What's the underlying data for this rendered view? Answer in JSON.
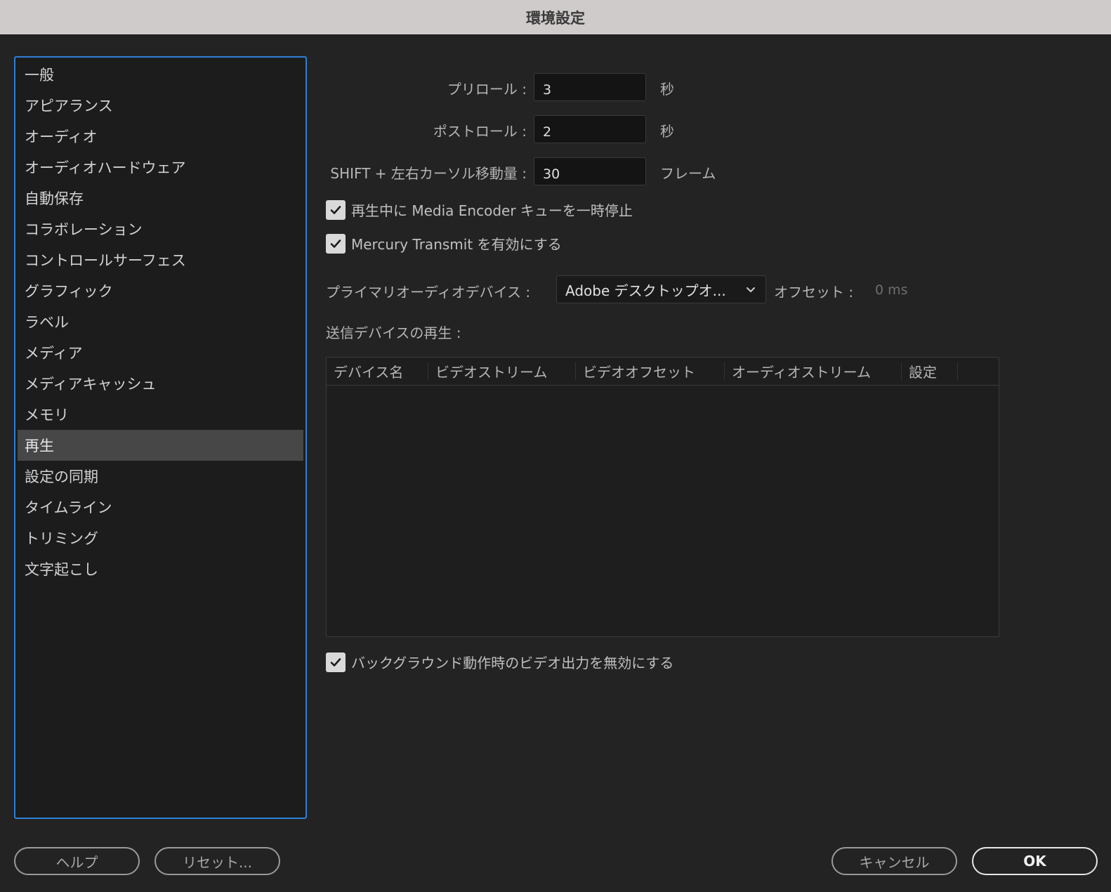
{
  "window": {
    "title": "環境設定"
  },
  "sidebar": {
    "items": [
      {
        "label": "一般"
      },
      {
        "label": "アピアランス"
      },
      {
        "label": "オーディオ"
      },
      {
        "label": "オーディオハードウェア"
      },
      {
        "label": "自動保存"
      },
      {
        "label": "コラボレーション"
      },
      {
        "label": "コントロールサーフェス"
      },
      {
        "label": "グラフィック"
      },
      {
        "label": "ラベル"
      },
      {
        "label": "メディア"
      },
      {
        "label": "メディアキャッシュ"
      },
      {
        "label": "メモリ"
      },
      {
        "label": "再生"
      },
      {
        "label": "設定の同期"
      },
      {
        "label": "タイムライン"
      },
      {
        "label": "トリミング"
      },
      {
        "label": "文字起こし"
      }
    ],
    "selected_index": 12
  },
  "playback": {
    "preroll_label": "プリロール :",
    "preroll_value": "3",
    "preroll_unit": "秒",
    "postroll_label": "ポストロール :",
    "postroll_value": "2",
    "postroll_unit": "秒",
    "shift_label": "SHIFT + 左右カーソル移動量 :",
    "shift_value": "30",
    "shift_unit": "フレーム",
    "pause_encoder_label": "再生中に Media Encoder キューを一時停止",
    "pause_encoder_checked": true,
    "mercury_label": "Mercury Transmit を有効にする",
    "mercury_checked": true,
    "audio_device_label": "プライマリオーディオデバイス :",
    "audio_device_value": "Adobe デスクトップオ...",
    "offset_label": "オフセット :",
    "offset_value": "0 ms",
    "transmit_label": "送信デバイスの再生 :",
    "table_headers": [
      "デバイス名",
      "ビデオストリーム",
      "ビデオオフセット",
      "オーディオストリーム",
      "設定"
    ],
    "background_label": "バックグラウンド動作時のビデオ出力を無効にする",
    "background_checked": true
  },
  "footer": {
    "help_label": "ヘルプ",
    "reset_label": "リセット...",
    "cancel_label": "キャンセル",
    "ok_label": "OK"
  },
  "colors": {
    "accent": "#2e7fd6",
    "selected_bg": "#474747"
  }
}
